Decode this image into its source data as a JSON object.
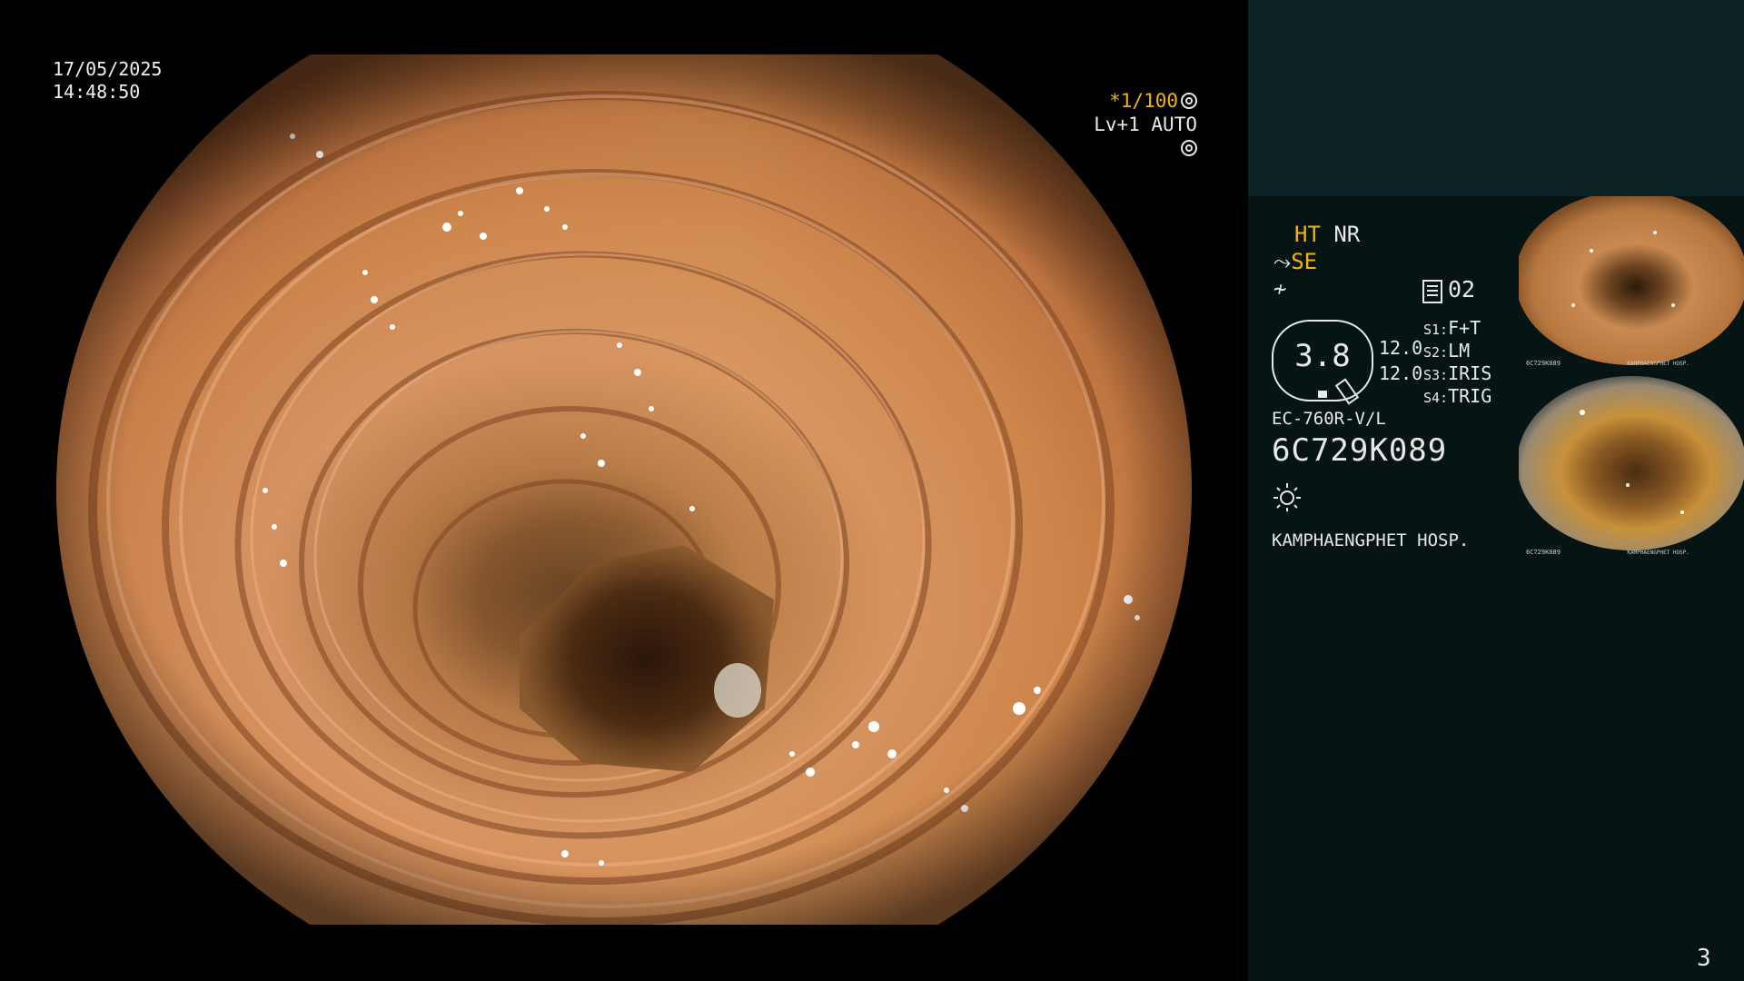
{
  "overlay": {
    "date": "17/05/2025",
    "time": "14:48:50",
    "shutter": "*1/100",
    "level": "Lv+1 AUTO"
  },
  "panel": {
    "ht": "HT",
    "nr": "NR",
    "se": "SE",
    "f_symbol": "≁",
    "record_count": "02",
    "zoom": "3.8",
    "level_a": "12.0",
    "level_b": "12.0",
    "switches": [
      {
        "key": "S1:",
        "value": "F+T"
      },
      {
        "key": "S2:",
        "value": "LM"
      },
      {
        "key": "S3:",
        "value": "IRIS"
      },
      {
        "key": "S4:",
        "value": "TRIG"
      }
    ],
    "scope_model": "EC-760R-V/L",
    "serial": "6C729K089",
    "hospital": "KAMPHAENGPHET HOSP."
  },
  "thumbnails": [
    {
      "caption": "6C729K089",
      "footer": "KAMPHAENGPHET HOSP."
    },
    {
      "caption": "6C729K089",
      "footer": "KAMPHAENGPHET HOSP."
    }
  ],
  "page_number": "3",
  "colors": {
    "accent_yellow": "#f5b400",
    "panel_top": "#0d2426",
    "panel_bottom": "#061413",
    "mucosa": "#c9824f"
  },
  "icons": [
    "shutter-icon",
    "auto-iris-icon",
    "fiber-icon",
    "record-icon",
    "zoom-badge",
    "light-source-icon"
  ]
}
